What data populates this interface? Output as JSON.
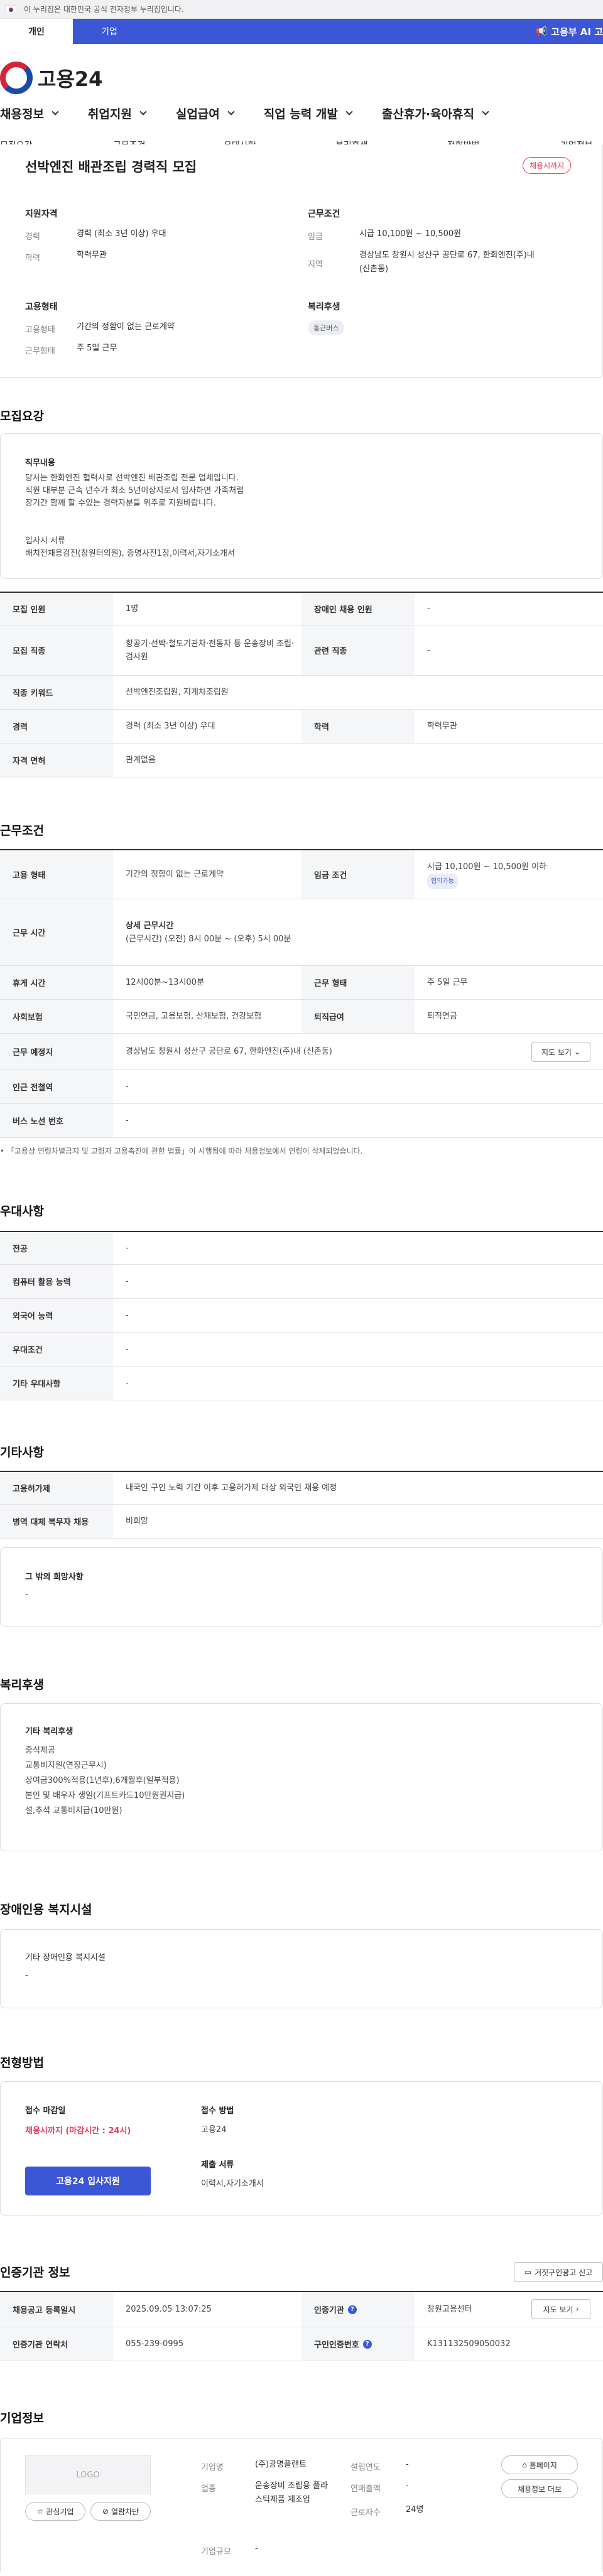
{
  "gov_banner": "이 누리집은 대한민국 공식 전자정부 누리집입니다.",
  "top_tabs": [
    "개인",
    "기업"
  ],
  "ai_link": "고용부 AI 고",
  "logo_text": "고용24",
  "main_menu": [
    "채용정보",
    "취업지원",
    "실업급여",
    "직업 능력 개발",
    "출산휴가·육아휴직"
  ],
  "anchors": [
    "모집요강",
    "근무조건",
    "우대사항",
    "복리후생",
    "전형방법",
    "기업정보"
  ],
  "job": {
    "title": "선박엔진 배관조립 경력직 모집",
    "status_badge": "채용시까지",
    "qual_title": "지원자격",
    "qual": [
      {
        "k": "경력",
        "v": "경력 (최소 3년 이상) 우대"
      },
      {
        "k": "학력",
        "v": "학력무관"
      }
    ],
    "cond_title": "근무조건",
    "cond": [
      {
        "k": "임금",
        "v": "시급 10,100원 ~ 10,500원"
      },
      {
        "k": "지역",
        "v": "경상남도 창원시 성산구 공단로 67, 한화엔진(주)내 (신촌동)"
      }
    ],
    "emp_title": "고용형태",
    "emp": [
      {
        "k": "고용형태",
        "v": "기간의 정함이 없는 근로계약"
      },
      {
        "k": "근무형태",
        "v": "주 5일 근무"
      }
    ],
    "welfare_title": "복리후생",
    "welfare_tag": "통근버스"
  },
  "recruit": {
    "section": "모집요강",
    "duty_title": "직무내용",
    "duty_text": "당사는 한화엔진 협력사로 선박엔진 배관조립 전문 업체입니다.\n직원 대부분 근속 년수가 최소 5년이상지로서 입사하면 가족처럼\n장기간 함께 할 수있는 경력자분들 위주로 지원바랍니다.\n\n\n입사시 서류\n배치전채용검진(창원터의원), 증명사진1장,이력서,자기소개서",
    "rows": [
      {
        "k": "모집 인원",
        "v": "1명",
        "k2": "장애인 채용 인원",
        "v2": "-"
      },
      {
        "k": "모집 직종",
        "v": "항공기·선박·철도기관차·전동차 등 운송장비 조립·검사원",
        "k2": "관련 직종",
        "v2": "-"
      },
      {
        "k": "직종 키워드",
        "v": "선박엔진조립원, 지게차조립원"
      },
      {
        "k": "경력",
        "v": "경력 (최소 3년 이상) 우대",
        "k2": "학력",
        "v2": "학력무관"
      },
      {
        "k": "자격 면허",
        "v": "관계없음"
      }
    ]
  },
  "work": {
    "section": "근무조건",
    "rows": [
      {
        "k": "고용 형태",
        "v": "기간의 정함이 없는 근로계약",
        "k2": "임금 조건",
        "v2": "시급 10,100원 ~ 10,500원 이하",
        "chip": "협의가능"
      },
      {
        "k": "근무 시간",
        "v_title": "상세 근무시간",
        "v": "(근무시간) (오전) 8시 00분 ~ (오후) 5시 00분"
      },
      {
        "k": "휴게 시간",
        "v": "12시00분~13시00분",
        "k2": "근무 형태",
        "v2": "주 5일 근무"
      },
      {
        "k": "사회보험",
        "v": "국민연금, 고용보험, 산재보험, 건강보험",
        "k2": "퇴직급여",
        "v2": "퇴직연금"
      },
      {
        "k": "근무 예정지",
        "v": "경상남도 창원시 성산구 공단로 67, 한화엔진(주)내 (신촌동)",
        "btn": "지도 보기"
      },
      {
        "k": "인근 전철역",
        "v": "-"
      },
      {
        "k": "버스 노선 번호",
        "v": "-"
      }
    ],
    "note": "「고용상 연령차별금지 및 고령자 고용촉진에 관한 법률」이 시행됨에 따라 채용정보에서 연령이 삭제되었습니다."
  },
  "pref": {
    "section": "우대사항",
    "rows": [
      {
        "k": "전공",
        "v": "-"
      },
      {
        "k": "컴퓨터 활용 능력",
        "v": "-"
      },
      {
        "k": "외국어 능력",
        "v": "-"
      },
      {
        "k": "우대조건",
        "v": "-"
      },
      {
        "k": "기타 우대사항",
        "v": "-"
      }
    ]
  },
  "etc": {
    "section": "기타사항",
    "rows": [
      {
        "k": "고용허가제",
        "v": "내국인 구인 노력 기간 이후 고용허가제 대상 외국인 채용 예정"
      },
      {
        "k": "병역 대체 복무자 채용",
        "v": "비희망"
      }
    ],
    "other_title": "그 밖의 희망사항",
    "other_value": "-"
  },
  "benefits": {
    "section": "복리후생",
    "title": "기타 복리후생",
    "text": "중식제공\n교통비지원(연장근무시)\n상여금300%적용(1년후),6개월후(일부적용)\n본인 및 배우자 생일(기프트카드10만원권지급)\n설,추석 교통비지급(10만원)"
  },
  "disability": {
    "section": "장애인용 복지시설",
    "title": "기타 장애인용 복지시설",
    "value": "-"
  },
  "selection": {
    "section": "전형방법",
    "deadline_title": "접수 마감일",
    "deadline_value": "채용시까지 (마감시간 : 24시)",
    "method_title": "접수 방법",
    "method_value": "고용24",
    "docs_title": "제출 서류",
    "docs_value": "이력서,자기소개서",
    "apply_button": "고용24 입사지원"
  },
  "cert": {
    "section": "인증기관 정보",
    "report_button": "거짓구인광고 신고",
    "rows": [
      {
        "k": "채용공고 등록일시",
        "v": "2025.09.05 13:07:25",
        "k2": "인증기관",
        "v2": "창원고용센터",
        "btn": "지도 보기"
      },
      {
        "k": "인증기관 연락처",
        "v": "055-239-0995",
        "k2": "구인인증번호",
        "v2": "K131132509050032"
      }
    ]
  },
  "company": {
    "section": "기업정보",
    "logo_placeholder": "LOGO",
    "fav_button": "관심기업",
    "block_button": "열람차단",
    "fields": [
      {
        "k": "기업명",
        "v": "(주)광명플랜트"
      },
      {
        "k": "업종",
        "v": "운송장비 조립용 플라스틱제품 제조업"
      },
      {
        "k": "기업규모",
        "v": "-"
      },
      {
        "k": "설립연도",
        "v": "-"
      },
      {
        "k": "연매출액",
        "v": "-"
      },
      {
        "k": "근로자수",
        "v": "24명"
      }
    ],
    "homepage_button": "홈페이지",
    "jobs_button": "채용정보 더보"
  }
}
